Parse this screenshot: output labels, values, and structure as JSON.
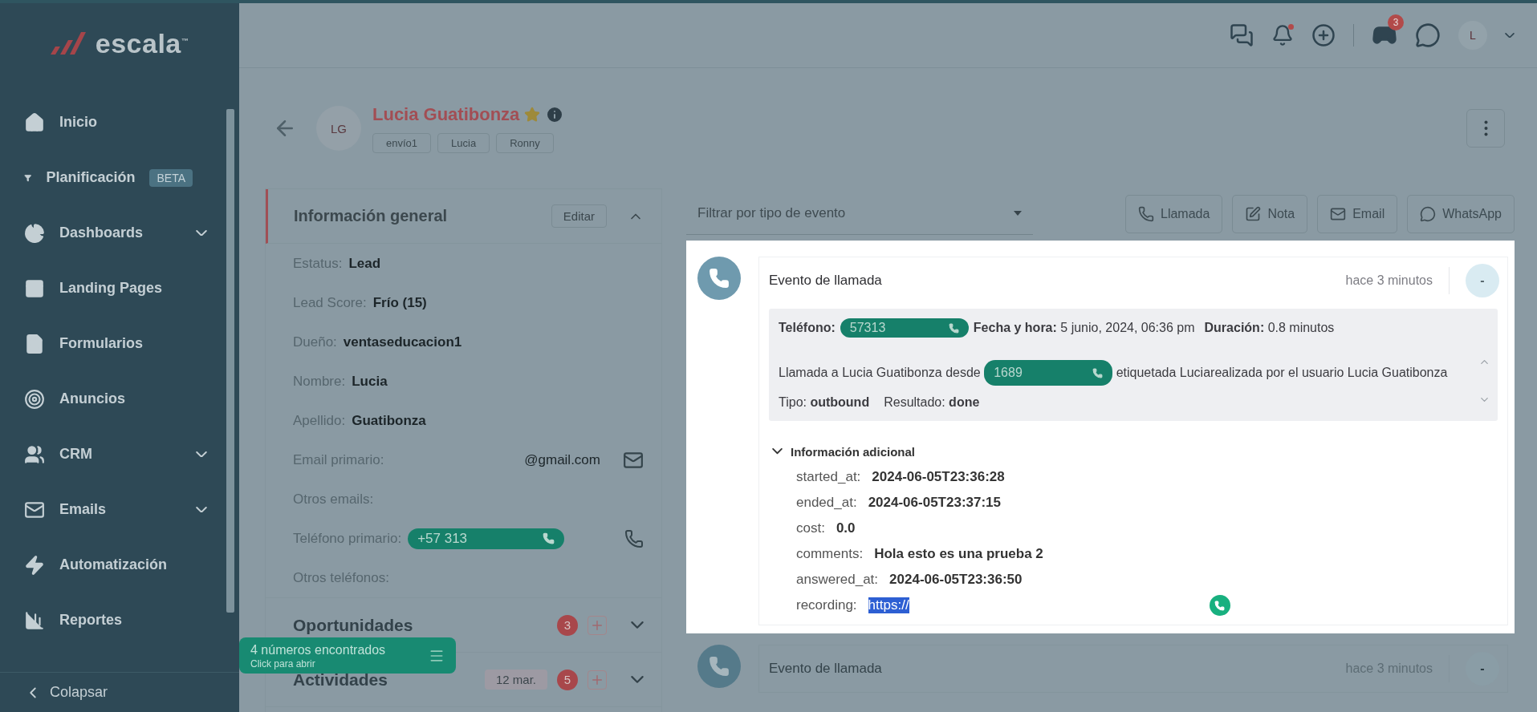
{
  "sidebar": {
    "logo": "escala",
    "logo_mark": "™",
    "items": [
      {
        "label": "Inicio",
        "expandable": false
      },
      {
        "label": "Planificación",
        "badge": "BETA",
        "expandable": false
      },
      {
        "label": "Dashboards",
        "expandable": true
      },
      {
        "label": "Landing Pages",
        "expandable": false
      },
      {
        "label": "Formularios",
        "expandable": false
      },
      {
        "label": "Anuncios",
        "expandable": false
      },
      {
        "label": "CRM",
        "expandable": true
      },
      {
        "label": "Emails",
        "expandable": true
      },
      {
        "label": "Automatización",
        "expandable": false
      },
      {
        "label": "Reportes",
        "expandable": false
      }
    ],
    "collapse": "Colapsar"
  },
  "header": {
    "chat_count": "3",
    "avatar": "L"
  },
  "contact": {
    "initials": "LG",
    "name": "Lucia Guatibonza",
    "starred": true,
    "tags": [
      "envío1",
      "Lucia",
      "Ronny"
    ]
  },
  "general_info": {
    "title": "Información general",
    "edit": "Editar",
    "expanded": true,
    "fields": [
      {
        "label": "Estatus:",
        "value": "Lead"
      },
      {
        "label": "Lead Score:",
        "value": "Frío (15)"
      },
      {
        "label": "Dueño:",
        "value": "ventaseducacion1"
      },
      {
        "label": "Nombre:",
        "value": "Lucia"
      },
      {
        "label": "Apellido:",
        "value": "Guatibonza"
      },
      {
        "label": "Email primario:",
        "value": "@gmail.com",
        "kind": "email"
      },
      {
        "label": "Otros emails:"
      },
      {
        "label": "Teléfono primario:",
        "value": "+57 313",
        "kind": "phone"
      },
      {
        "label": "Otros teléfonos:"
      }
    ]
  },
  "sections": [
    {
      "title": "Oportunidades",
      "count": "3"
    },
    {
      "title": "Actividades",
      "date": "12 mar.",
      "count": "5"
    }
  ],
  "toast": {
    "title": "4 números encontrados",
    "subtitle": "Click para abrir"
  },
  "timeline": {
    "filter_placeholder": "Filtrar por tipo de evento",
    "actions": [
      "Llamada",
      "Nota",
      "Email",
      "WhatsApp"
    ],
    "events": [
      {
        "title": "Evento de llamada",
        "time": "hace 3 minutos",
        "menu": "-",
        "highlighted": true,
        "details": {
          "phone_label": "Teléfono:",
          "phone": "57313",
          "date_label": "Fecha y hora:",
          "date": "5 junio, 2024, 06:36 pm",
          "duration_label": "Duración:",
          "duration": "0.8 minutos",
          "text_before": "Llamada a Lucia Guatibonza desde",
          "from_phone": "1689",
          "text_after": "etiquetada Luciarealizada por el usuario Lucia Guatibonza",
          "type_label": "Tipo:",
          "type": "outbound",
          "result_label": "Resultado:",
          "result": "done"
        },
        "extra": {
          "title": "Información adicional",
          "expanded": true,
          "rows": [
            {
              "key": "started_at:",
              "value": "2024-06-05T23:36:28",
              "selected": false
            },
            {
              "key": "ended_at:",
              "value": "2024-06-05T23:37:15",
              "selected": false
            },
            {
              "key": "cost:",
              "value": "0.0",
              "selected": false
            },
            {
              "key": "comments:",
              "value": "Hola esto es una prueba 2",
              "selected": false
            },
            {
              "key": "answered_at:",
              "value": "2024-06-05T23:36:50",
              "selected": false
            },
            {
              "key": "recording:",
              "value": "https://",
              "selected": true
            }
          ]
        }
      },
      {
        "title": "Evento de llamada",
        "time": "hace 3 minutos",
        "menu": "-",
        "highlighted": false
      }
    ]
  }
}
